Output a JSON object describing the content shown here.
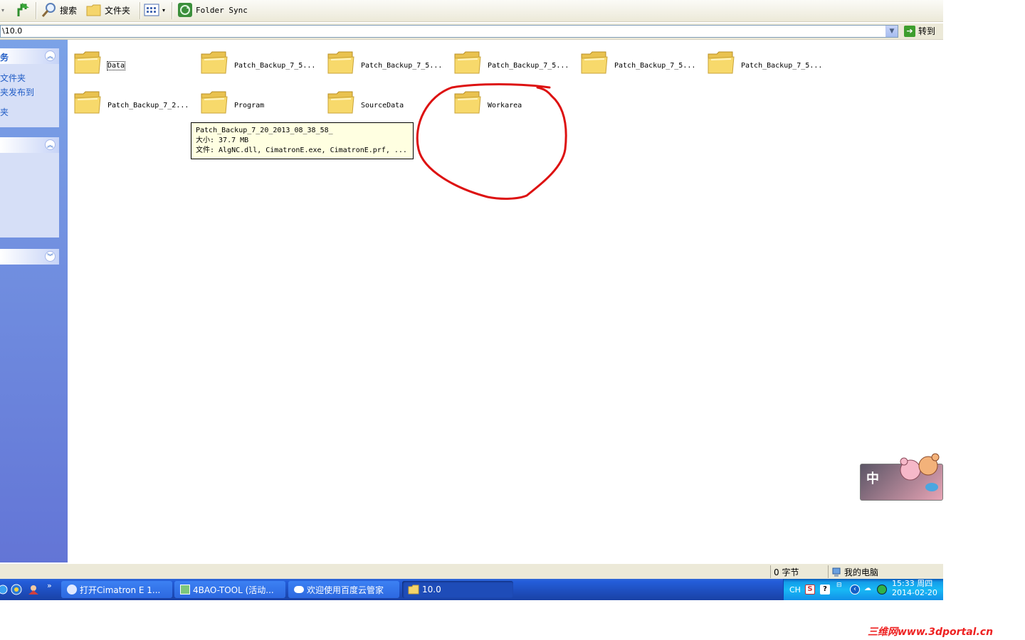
{
  "toolbar": {
    "search_label": "搜索",
    "folders_label": "文件夹",
    "sync_label": "Folder Sync"
  },
  "address": {
    "path": "\\10.0",
    "go_label": "转到"
  },
  "left_pane": {
    "panel1_title": "务",
    "panel1_links": [
      "文件夹",
      "夹发布到",
      "夹"
    ]
  },
  "folders": [
    {
      "name": "Data"
    },
    {
      "name": "Patch_Backup_7_5..."
    },
    {
      "name": "Patch_Backup_7_5..."
    },
    {
      "name": "Patch_Backup_7_5..."
    },
    {
      "name": "Patch_Backup_7_5..."
    },
    {
      "name": "Patch_Backup_7_5..."
    },
    {
      "name": "Patch_Backup_7_2..."
    },
    {
      "name": "Program"
    },
    {
      "name": "SourceData"
    },
    {
      "name": "Workarea"
    }
  ],
  "tooltip": {
    "line1": "Patch_Backup_7_20_2013_08_38_58_",
    "line2": "大小: 37.7 MB",
    "line3": "文件: AlgNC.dll, CimatronE.exe, CimatronE.prf, ..."
  },
  "ime": {
    "char": "中"
  },
  "status": {
    "size": "0 字节",
    "location": "我的电脑"
  },
  "taskbar": {
    "tasks": [
      {
        "label": "打开Cimatron E 1..."
      },
      {
        "label": "4BAO-TOOL (活动..."
      },
      {
        "label": "欢迎使用百度云管家"
      },
      {
        "label": "10.0"
      }
    ],
    "tray_lang": "CH",
    "time": "15:33 周四",
    "date": "2014-02-20"
  },
  "watermark": "三维网www.3dportal.cn",
  "colors": {
    "annotation_circle": "#dd1111",
    "folder_fill": "#f7d96b",
    "selection": "#215dc6"
  }
}
